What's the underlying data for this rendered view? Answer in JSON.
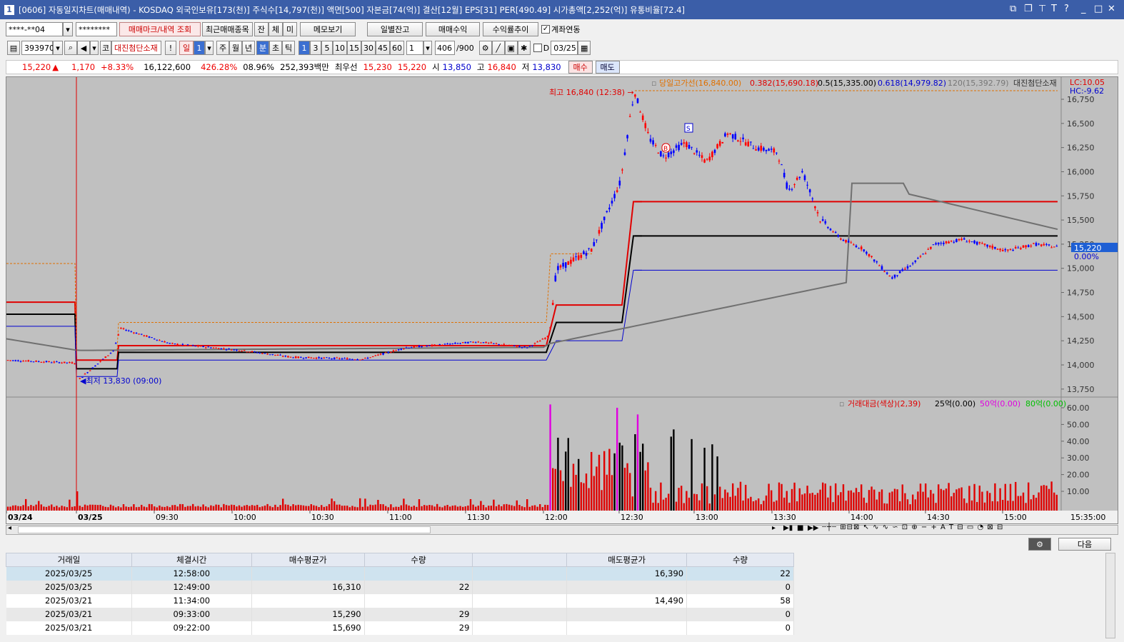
{
  "window": {
    "icon": "1",
    "title": "[0606] 자동일지차트(매매내역) - KOSDAQ 외국인보유[173(천)] 주식수[14,797(천)] 액면[500] 자본금[74(억)] 결산[12월] EPS[31] PER[490.49] 시가총액[2,252(억)] 유통비율[72.4]"
  },
  "toolbar1": {
    "account": "****-**04",
    "password": "********",
    "query_btn": "매매마크/내역 조회",
    "recent_btn": "최근매매종목",
    "jan": "잔",
    "che": "체",
    "mi": "미",
    "memo_btn": "메모보기",
    "daily_btn": "일별잔고",
    "profit_btn": "매매수익",
    "rate_btn": "수익률추이",
    "link_label": "계좌연동"
  },
  "toolbar2": {
    "code": "393970",
    "ko": "코",
    "name": "대진첨단소재",
    "excl": "!",
    "day": "일",
    "day_n": "1",
    "week": "주",
    "month": "월",
    "year": "년",
    "min": "분",
    "sec": "초",
    "tick": "틱",
    "intervals": [
      "1",
      "3",
      "5",
      "10",
      "15",
      "30",
      "45",
      "60"
    ],
    "int_sel": "1",
    "count": "406",
    "count_max": "/900",
    "d_label": "D",
    "date": "03/25"
  },
  "quote": {
    "price": "15,220",
    "arrow": "▲",
    "change": "1,170",
    "pct": "+8.33%",
    "volume": "16,122,600",
    "vol_rate": "426.28%",
    "turnover": "08.96%",
    "amount": "252,393백만",
    "best_label": "최우선",
    "ask": "15,230",
    "bid": "15,220",
    "open_l": "시",
    "open": "13,850",
    "high_l": "고",
    "high": "16,840",
    "low_l": "저",
    "low": "13,830",
    "buy_btn": "매수",
    "sell_btn": "매도"
  },
  "price_legend": {
    "a": "당일고가선(16,840.00)",
    "b": "0.382(15,690.18)",
    "c": "0.5(15,335.00)",
    "d": "0.618(14,979.82)",
    "e": "120(15,392.79)",
    "name": "대진첨단소재",
    "lc": "LC:10.05",
    "hc": "HC:-9.62"
  },
  "price_axis": [
    "16,750",
    "16,500",
    "16,250",
    "16,000",
    "15,750",
    "15,500",
    "15,250",
    "15,000",
    "14,750",
    "14,500",
    "14,250",
    "14,000",
    "13,750"
  ],
  "cur_price_tag": "15,220",
  "cur_pct_tag": "0.00%",
  "annotations": {
    "high": "최고 16,840 (12:38)",
    "low": "최저 13,830 (09:00)",
    "buy": "B",
    "sell": "S"
  },
  "vol_legend": {
    "a": "거래대금(색상)(2,39)",
    "b": "25억(0.00)",
    "c": "50억(0.00)",
    "d": "80억(0.00)"
  },
  "vol_axis": [
    "60.00",
    "50.00",
    "40.00",
    "30.00",
    "20.00",
    "10.00"
  ],
  "time_axis": [
    "03/24",
    "03/25",
    "09:30",
    "10:00",
    "10:30",
    "11:00",
    "11:30",
    "12:00",
    "12:30",
    "13:00",
    "13:30",
    "14:00",
    "14:30",
    "15:00"
  ],
  "time_right": "15:35:00",
  "next_btn": "다음",
  "table": {
    "headers": [
      "거래일",
      "체결시간",
      "매수평균가",
      "수량",
      "",
      "매도평균가",
      "수량"
    ],
    "rows": [
      [
        "2025/03/25",
        "12:58:00",
        "",
        "",
        "",
        "16,390",
        "22"
      ],
      [
        "2025/03/25",
        "12:49:00",
        "16,310",
        "22",
        "",
        "",
        "0"
      ],
      [
        "2025/03/21",
        "11:34:00",
        "",
        "",
        "",
        "14,490",
        "58"
      ],
      [
        "2025/03/21",
        "09:33:00",
        "15,290",
        "29",
        "",
        "",
        "0"
      ],
      [
        "2025/03/21",
        "09:22:00",
        "15,690",
        "29",
        "",
        "",
        "0"
      ]
    ]
  },
  "colors": {
    "up": "#ff0000",
    "down": "#0000ff",
    "title_bar": "#3b5ea8"
  }
}
